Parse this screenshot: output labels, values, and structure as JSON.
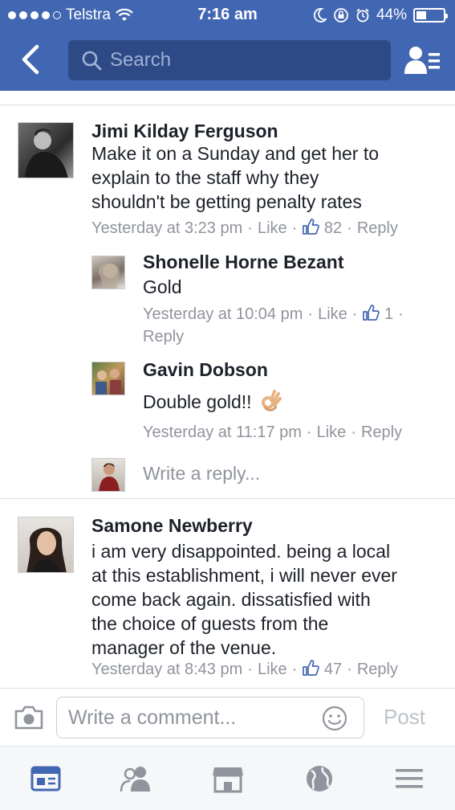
{
  "status_bar": {
    "carrier": "Telstra",
    "time": "7:16 am",
    "battery": "44%",
    "battery_level": 0.44
  },
  "header": {
    "search_placeholder": "Search",
    "back_icon": "chevron-left-icon",
    "friends_icon": "friend-list-icon"
  },
  "comments": [
    {
      "name": "Jimi Kilday Ferguson",
      "text_lines": [
        "Make it on a Sunday and get her to",
        "explain to the staff why they",
        "shouldn't be getting penalty rates"
      ],
      "time": "Yesterday at 3:23 pm",
      "like": "Like",
      "likes": "82",
      "reply": "Reply",
      "replies": [
        {
          "name": "Shonelle Horne Bezant",
          "text": "Gold",
          "time": "Yesterday at 10:04 pm",
          "like": "Like",
          "likes": "1",
          "reply": "Reply"
        },
        {
          "name": "Gavin Dobson",
          "text": "Double gold!!",
          "emoji": "ok-hand-emoji",
          "time": "Yesterday at 11:17 pm",
          "like": "Like",
          "reply": "Reply"
        }
      ],
      "write_reply": "Write a reply..."
    },
    {
      "name": "Samone Newberry",
      "text_lines": [
        "i am very disappointed. being a local",
        "at this establishment, i will never ever",
        "come back again. dissatisfied with",
        "the choice of guests from the",
        "manager of the venue."
      ],
      "time": "Yesterday at 8:43 pm",
      "like": "Like",
      "likes": "47",
      "reply": "Reply"
    }
  ],
  "composer": {
    "placeholder": "Write a comment...",
    "post_label": "Post",
    "camera_icon": "camera-icon",
    "emoji_icon": "smiley-icon"
  },
  "tabbar": {
    "tabs": [
      "news-feed-icon",
      "friends-icon",
      "marketplace-icon",
      "globe-icon",
      "menu-icon"
    ],
    "active_tab": "news-feed-icon"
  },
  "colors": {
    "brand": "#4267b2",
    "like_blue": "#4267b2",
    "meta_gray": "#90949c"
  }
}
